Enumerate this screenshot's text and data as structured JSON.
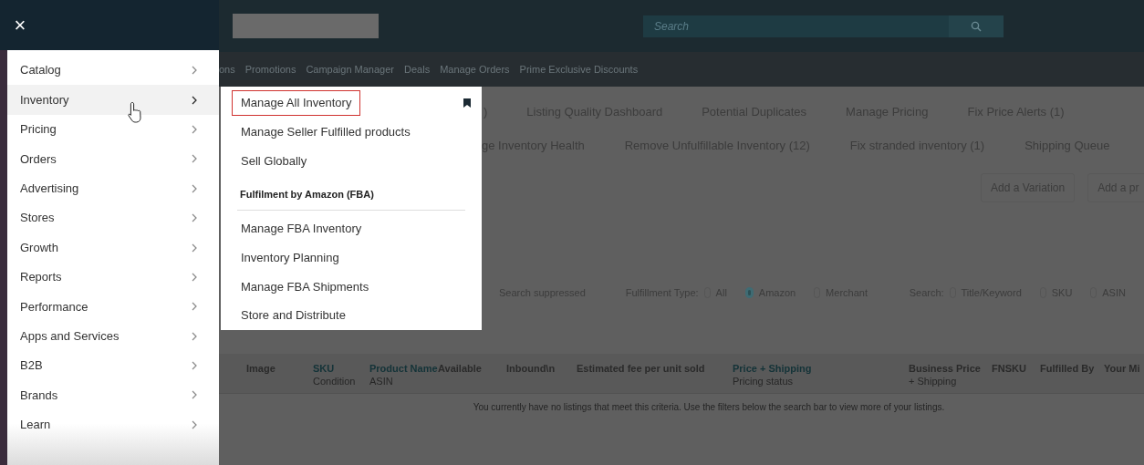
{
  "close_button": {
    "label": "×"
  },
  "menu": {
    "items": [
      {
        "label": "Catalog",
        "selected": false
      },
      {
        "label": "Inventory",
        "selected": true
      },
      {
        "label": "Pricing",
        "selected": false
      },
      {
        "label": "Orders",
        "selected": false
      },
      {
        "label": "Advertising",
        "selected": false
      },
      {
        "label": "Stores",
        "selected": false
      },
      {
        "label": "Growth",
        "selected": false
      },
      {
        "label": "Reports",
        "selected": false
      },
      {
        "label": "Performance",
        "selected": false
      },
      {
        "label": "Apps and Services",
        "selected": false
      },
      {
        "label": "B2B",
        "selected": false
      },
      {
        "label": "Brands",
        "selected": false
      },
      {
        "label": "Learn",
        "selected": false
      }
    ]
  },
  "submenu": {
    "items": [
      {
        "kind": "link",
        "label": "Manage All Inventory",
        "outlined": true,
        "bookmarked": true
      },
      {
        "kind": "link",
        "label": "Manage Seller Fulfilled products",
        "outlined": false,
        "bookmarked": false
      },
      {
        "kind": "link",
        "label": "Sell Globally",
        "outlined": false,
        "bookmarked": false
      },
      {
        "kind": "heading",
        "label": "Fulfilment by Amazon (FBA)"
      },
      {
        "kind": "link",
        "label": "Manage FBA Inventory",
        "outlined": false,
        "bookmarked": false
      },
      {
        "kind": "link",
        "label": "Inventory Planning",
        "outlined": false,
        "bookmarked": false
      },
      {
        "kind": "link",
        "label": "Manage FBA Shipments",
        "outlined": false,
        "bookmarked": false
      },
      {
        "kind": "link",
        "label": "Store and Distribute",
        "outlined": false,
        "bookmarked": false
      }
    ]
  },
  "header": {
    "search": {
      "placeholder": "Search"
    }
  },
  "nav_links": [
    "ons",
    "Promotions",
    "Campaign Manager",
    "Deals",
    "Manage Orders",
    "Prime Exclusive Discounts"
  ],
  "tabs_row_1": [
    ")",
    "Listing Quality Dashboard",
    "Potential Duplicates",
    "Manage Pricing",
    "Fix Price Alerts (1)"
  ],
  "tabs_row_2": [
    "ge Inventory Health",
    "Remove Unfulfillable Inventory (12)",
    "Fix stranded inventory (1)",
    "Shipping Queue"
  ],
  "action_buttons": [
    "Add a Variation",
    "Add a pr"
  ],
  "filters": {
    "status_option": "Search suppressed",
    "fulfillment": {
      "label": "Fulfillment Type:",
      "options": [
        {
          "label": "All",
          "selected": false
        },
        {
          "label": "Amazon",
          "selected": true
        },
        {
          "label": "Merchant",
          "selected": false
        }
      ]
    },
    "search": {
      "label": "Search:",
      "options": [
        {
          "label": "Title/Keyword",
          "selected": false
        },
        {
          "label": "SKU",
          "selected": false
        },
        {
          "label": "ASIN",
          "selected": false
        }
      ]
    }
  },
  "table": {
    "columns": [
      {
        "kind": "plain",
        "label": "Image"
      },
      {
        "kind": "link",
        "label": "SKU",
        "sub": "Condition"
      },
      {
        "kind": "link",
        "label": "Product Name",
        "sub": "ASIN"
      },
      {
        "kind": "plain",
        "label": "Available"
      },
      {
        "kind": "plain",
        "label": "Inbound\\n"
      },
      {
        "kind": "plain",
        "label": "Estimated fee per unit sold"
      },
      {
        "kind": "link",
        "label": "Price + Shipping",
        "sub": "Pricing status"
      },
      {
        "kind": "plain",
        "label": "Business Price",
        "sub": "+ Shipping"
      },
      {
        "kind": "plain",
        "label": "FNSKU"
      },
      {
        "kind": "plain",
        "label": "Fulfilled By"
      },
      {
        "kind": "plain",
        "label": "Your Mi"
      }
    ],
    "empty_message": "You currently have no listings that meet this criteria. Use the filters below the search bar to view more of your listings."
  }
}
